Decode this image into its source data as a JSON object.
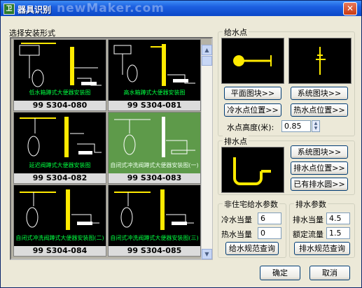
{
  "window": {
    "title": "器具识别",
    "watermark": "newMaker.com",
    "close_glyph": "✕"
  },
  "left": {
    "label": "选择安装形式",
    "thumbnails": [
      {
        "code": "99 S304-080",
        "caption": "低水箱蹲式大便器安装图",
        "selected": false
      },
      {
        "code": "99 S304-081",
        "caption": "高水箱蹲式大便器安装图",
        "selected": false
      },
      {
        "code": "99 S304-082",
        "caption": "延迟阀蹲式大便器安装图",
        "selected": false
      },
      {
        "code": "99 S304-083",
        "caption": "自闭式冲洗阀蹲式大便器安装图(一)",
        "selected": true
      },
      {
        "code": "99 S304-084",
        "caption": "自闭式冲洗阀蹲式大便器安装图(二)",
        "selected": false
      },
      {
        "code": "99 S304-085",
        "caption": "自闭式冲洗阀蹲式大便器安装图(三)",
        "selected": false
      }
    ]
  },
  "supply": {
    "title": "给水点",
    "btn_plan_block": "平面图块>>",
    "btn_system_block": "系统图块>>",
    "btn_cold_pos": "冷水点位置>>",
    "btn_hot_pos": "热水点位置>>",
    "height_label": "水点高度(米):",
    "height_value": "0.85"
  },
  "drain": {
    "title": "排水点",
    "btn_system_block": "系统图块>>",
    "btn_drain_pos": "排水点位置>>",
    "btn_existing_circle": "已有排水圆>>"
  },
  "nonres": {
    "title": "非住宅给水参数",
    "cold_label": "冷水当量",
    "cold_value": "6",
    "hot_label": "热水当量",
    "hot_value": "0",
    "btn_query": "给水规范查询"
  },
  "drain_params": {
    "title": "排水参数",
    "eq_label": "排水当量",
    "eq_value": "4.5",
    "flow_label": "额定流量",
    "flow_value": "1.5",
    "btn_query": "排水规范查询"
  },
  "footer": {
    "ok": "确定",
    "cancel": "取消"
  },
  "colors": {
    "drawing_yellow": "#ffea00",
    "drawing_green": "#00ff40",
    "selected_bg": "#5e9a4a"
  }
}
